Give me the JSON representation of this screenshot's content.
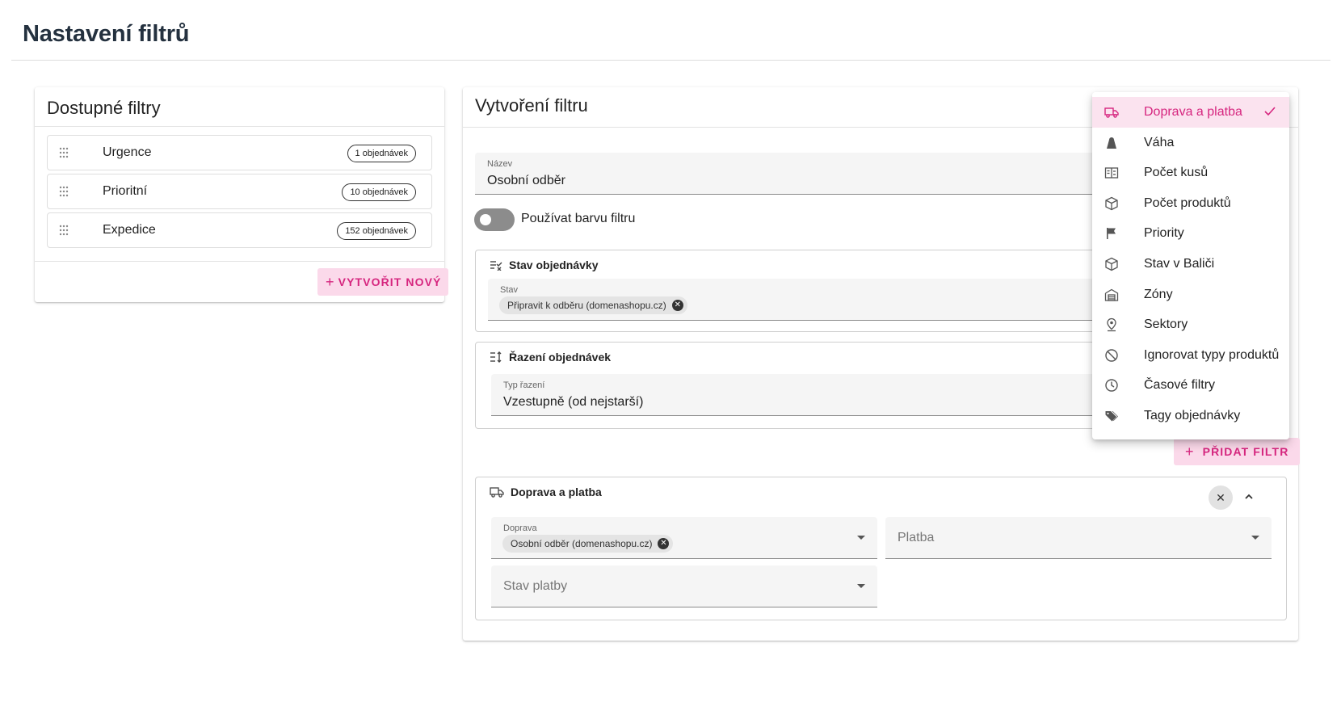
{
  "page": {
    "title": "Nastavení filtrů"
  },
  "available_filters": {
    "title": "Dostupné filtry",
    "items": [
      {
        "label": "Urgence",
        "count": "1 objednávek"
      },
      {
        "label": "Prioritní",
        "count": "10 objednávek"
      },
      {
        "label": "Expedice",
        "count": "152 objednávek"
      }
    ],
    "create_button": "Vytvořit nový"
  },
  "create_filter": {
    "title": "Vytvoření filtru",
    "name_field": {
      "label": "Název",
      "value": "Osobní odběr"
    },
    "color_toggle": {
      "label": "Používat barvu filtru",
      "on": false
    },
    "order_state": {
      "title": "Stav objednávky",
      "field_label": "Stav",
      "chips": [
        "Připravit k odběru (domenashopu.cz)"
      ]
    },
    "order_sort": {
      "title": "Řazení objednávek",
      "field_label": "Typ řazení",
      "value": "Vzestupně (od nejstarší)"
    },
    "add_filter_button": "Přidat filtr",
    "shipping_payment": {
      "title": "Doprava a platba",
      "shipping": {
        "label": "Doprava",
        "chips": [
          "Osobní odběr (domenashopu.cz)"
        ]
      },
      "payment": {
        "placeholder": "Platba"
      },
      "payment_state": {
        "placeholder": "Stav platby"
      }
    }
  },
  "filter_menu": {
    "accent_color": "#d6267f",
    "selected": "Doprava a platba",
    "items": [
      {
        "label": "Doprava a platba",
        "icon": "truck-icon"
      },
      {
        "label": "Váha",
        "icon": "weight-icon"
      },
      {
        "label": "Počet kusů",
        "icon": "counter-icon"
      },
      {
        "label": "Počet produktů",
        "icon": "package-icon"
      },
      {
        "label": "Priority",
        "icon": "flag-icon"
      },
      {
        "label": "Stav v Baliči",
        "icon": "box-icon"
      },
      {
        "label": "Zóny",
        "icon": "warehouse-icon"
      },
      {
        "label": "Sektory",
        "icon": "map-pin-icon"
      },
      {
        "label": "Ignorovat typy produktů",
        "icon": "block-icon"
      },
      {
        "label": "Časové filtry",
        "icon": "clock-icon"
      },
      {
        "label": "Tagy objednávky",
        "icon": "tags-icon"
      }
    ]
  }
}
